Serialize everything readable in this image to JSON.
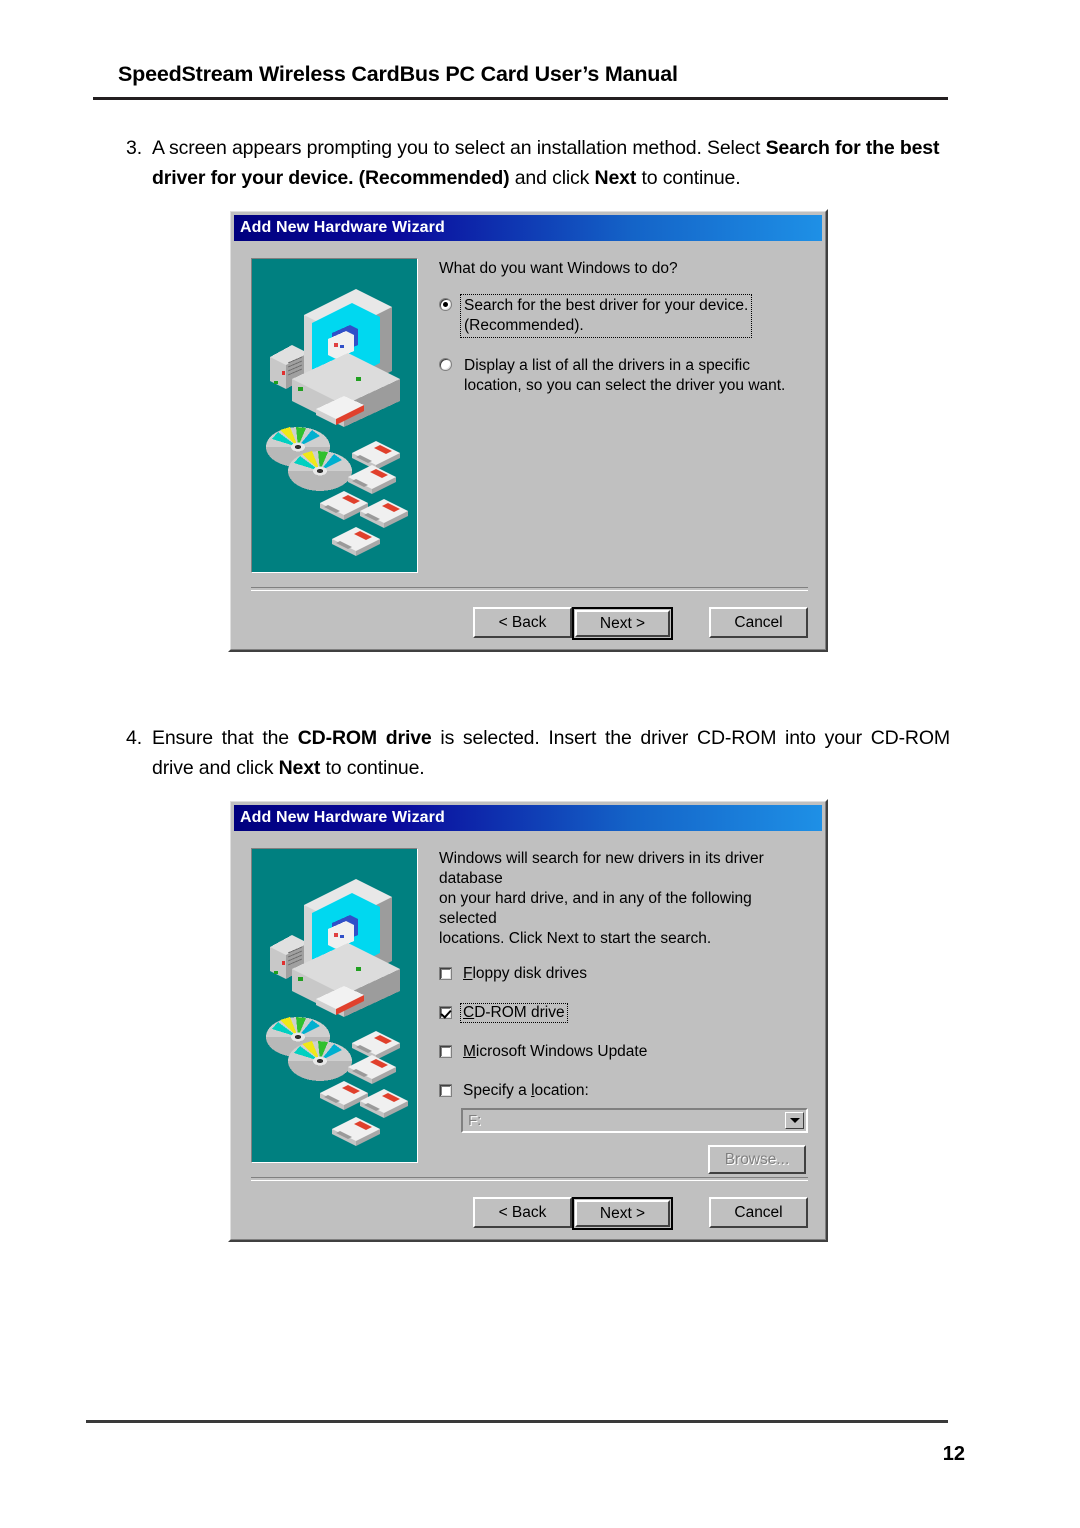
{
  "document": {
    "header_title": "SpeedStream Wireless CardBus PC Card User’s Manual",
    "page_number": "12"
  },
  "steps": [
    {
      "number": "3.",
      "segments": [
        {
          "text": "A screen appears prompting you to select an installation method. Select ",
          "bold": false
        },
        {
          "text": "Search for the best driver for your device. (Recommended)",
          "bold": true
        },
        {
          "text": " and click ",
          "bold": false
        },
        {
          "text": "Next",
          "bold": true
        },
        {
          "text": " to continue.",
          "bold": false
        }
      ],
      "full_text": "3. A screen appears prompting you to select an installation method. Select Search for the best driver for your device. (Recommended) and click Next to continue."
    },
    {
      "number": "4.",
      "segments": [
        {
          "text": "Ensure that the ",
          "bold": false
        },
        {
          "text": "CD-ROM drive",
          "bold": true
        },
        {
          "text": " is selected. Insert the driver CD-ROM into your CD-ROM drive and click ",
          "bold": false
        },
        {
          "text": "Next",
          "bold": true
        },
        {
          "text": " to continue.",
          "bold": false
        }
      ],
      "full_text": "4. Ensure that the CD-ROM drive is selected. Insert the driver CD-ROM into your CD-ROM drive and click Next to continue."
    }
  ],
  "dialog1": {
    "title": "Add New Hardware Wizard",
    "illustration_name": "computer-cds-floppies-illustration",
    "prompt": "What do you want Windows to do?",
    "options": [
      {
        "label_line1": "Search for the best driver for your device.",
        "label_line2": "(Recommended).",
        "selected": true,
        "focused": true
      },
      {
        "label_line1": "Display a list of all the drivers in a specific",
        "label_line2": "location, so you can select the driver you want.",
        "selected": false,
        "focused": false
      }
    ],
    "buttons": {
      "back": "< Back",
      "back_accesskey": "B",
      "next": "Next >",
      "cancel": "Cancel",
      "default_button": "Next >"
    }
  },
  "dialog2": {
    "title": "Add New Hardware Wizard",
    "illustration_name": "computer-cds-floppies-illustration",
    "prompt_line1": "Windows will search for new drivers in its driver database",
    "prompt_line2": "on your hard drive, and in any of the following selected",
    "prompt_line3": "locations. Click Next to start the search.",
    "checkboxes": [
      {
        "label_pre": "",
        "label_key": "F",
        "label_post": "loppy disk drives",
        "checked": false,
        "focused": false
      },
      {
        "label_pre": "",
        "label_key": "C",
        "label_post": "D-ROM drive",
        "checked": true,
        "focused": true
      },
      {
        "label_pre": "",
        "label_key": "M",
        "label_post": "icrosoft Windows Update",
        "checked": false,
        "focused": false
      },
      {
        "label_pre": "Specify a ",
        "label_key": "l",
        "label_post": "ocation:",
        "checked": false,
        "focused": false
      }
    ],
    "location_combo": {
      "value": "F:",
      "enabled": false
    },
    "browse_button": {
      "label": "Browse...",
      "enabled": false
    },
    "buttons": {
      "back": "< Back",
      "back_accesskey": "B",
      "next": "Next >",
      "cancel": "Cancel",
      "default_button": "Next >"
    }
  },
  "colors": {
    "dialog_face": "#c0c0c0",
    "titlebar_start": "#00007e",
    "titlebar_end": "#1e90e6",
    "illustration_bg": "#008080",
    "monitor_screen": "#00d8f0"
  }
}
